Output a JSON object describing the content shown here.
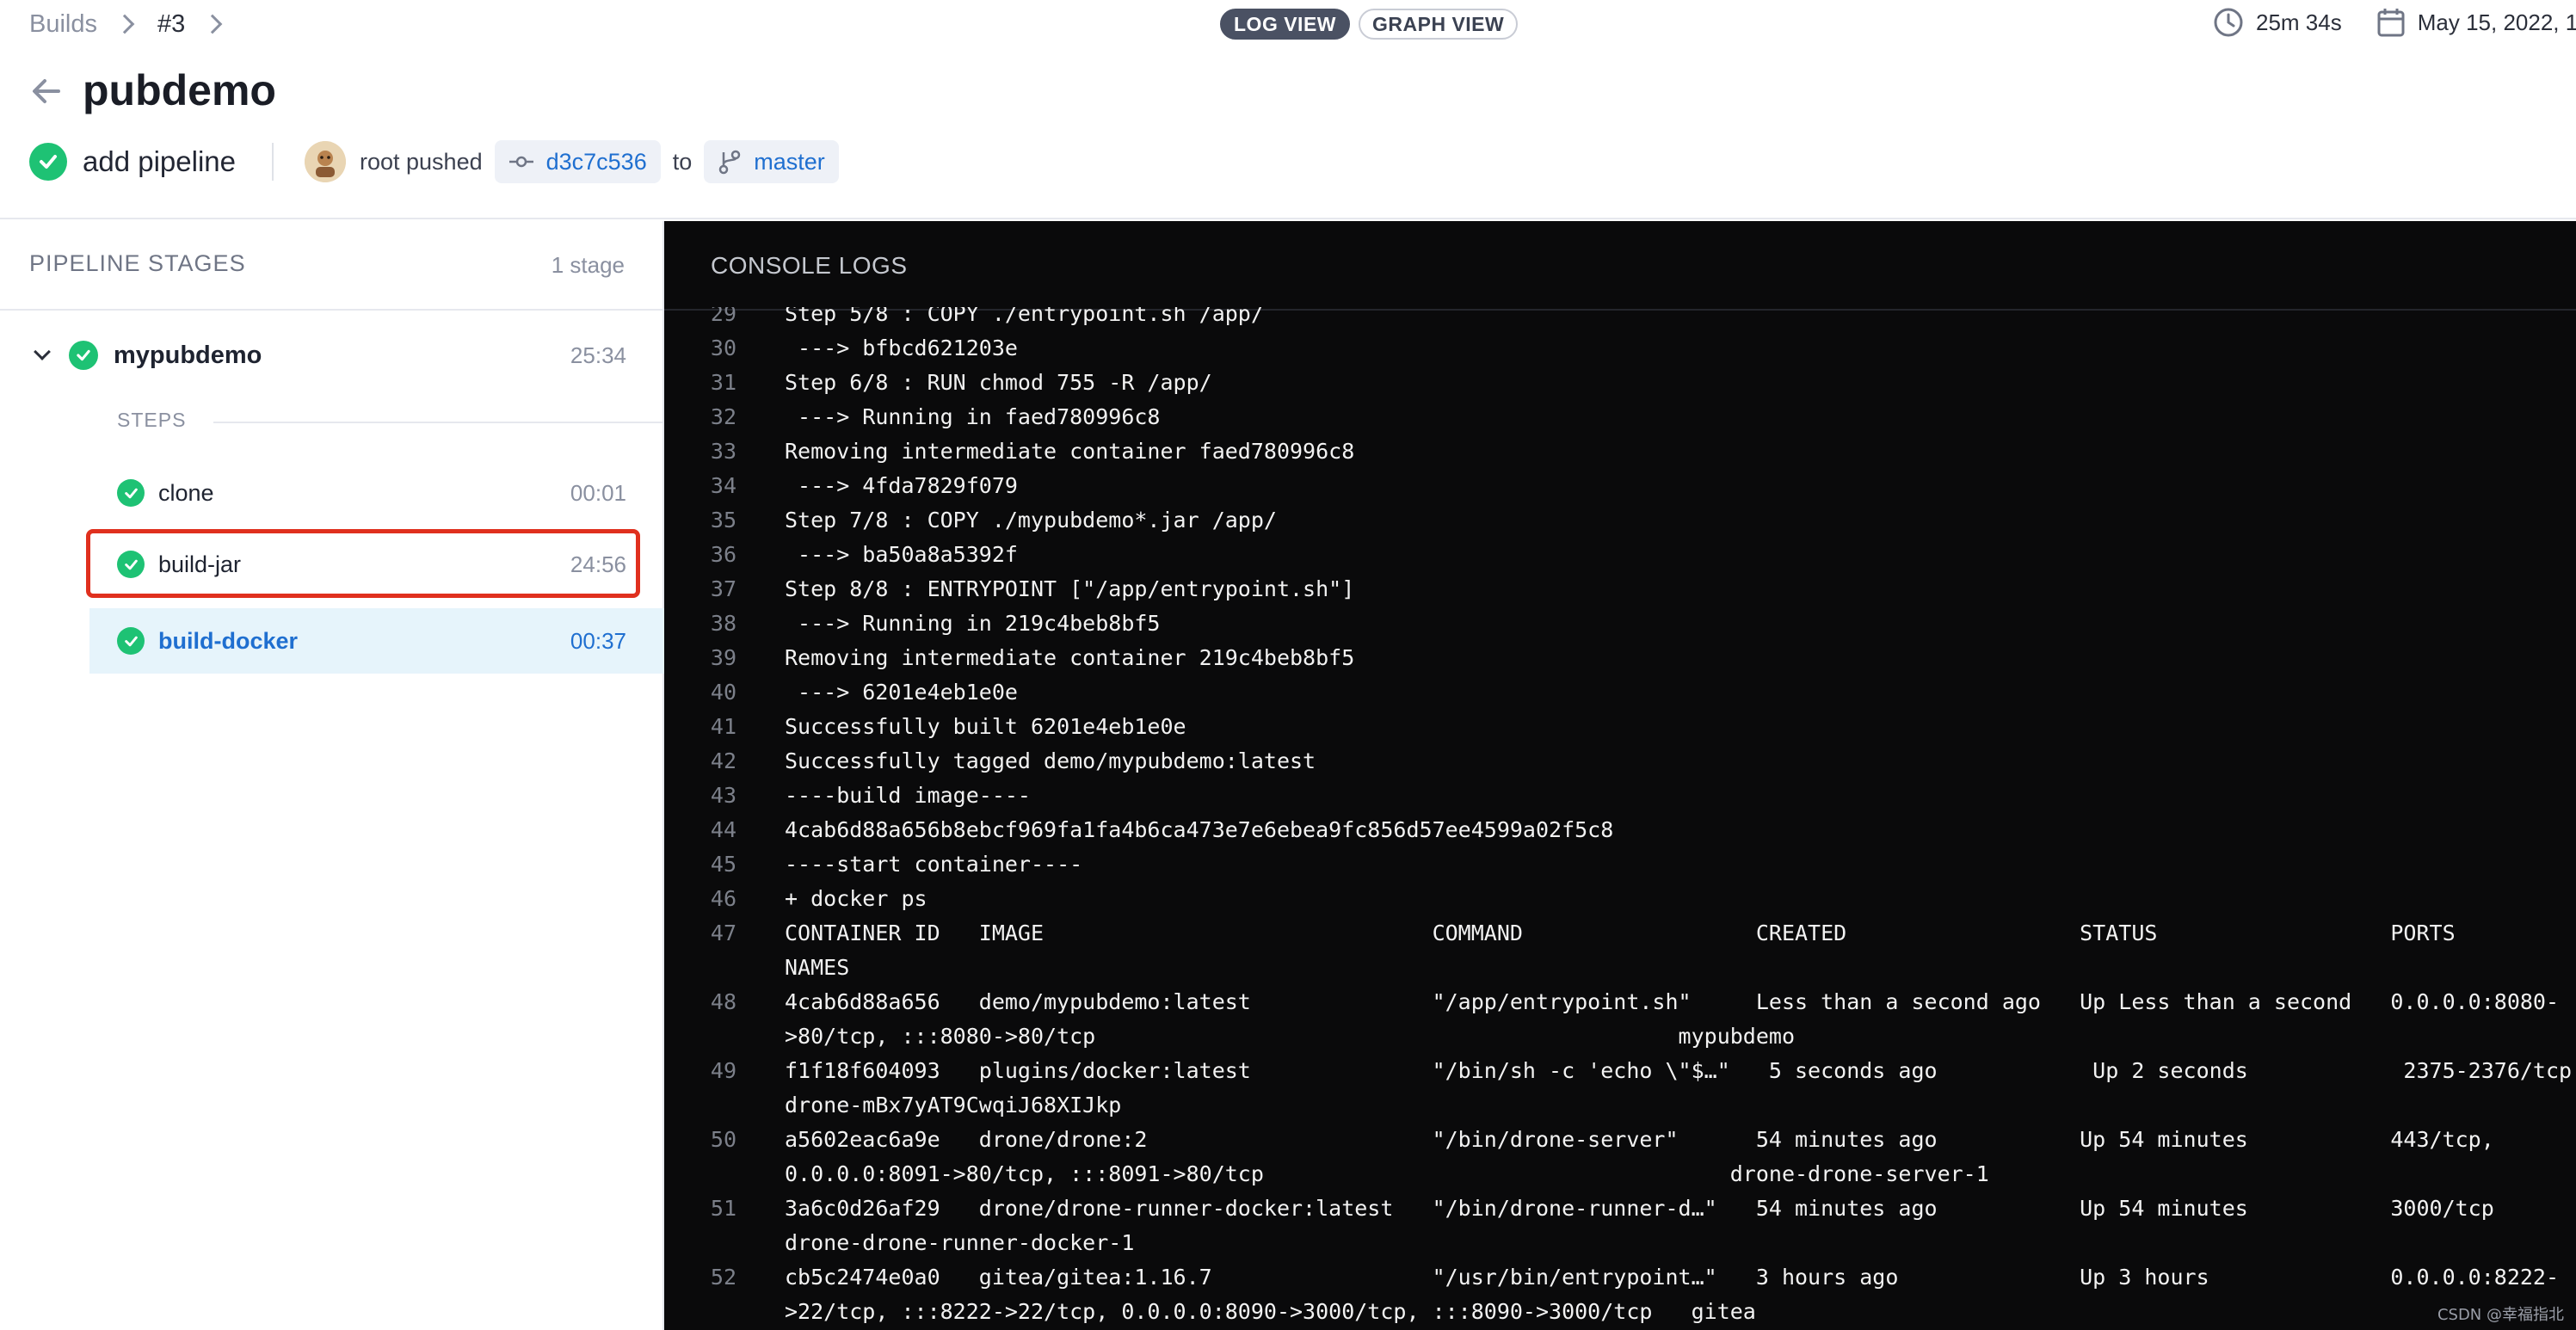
{
  "header": {
    "breadcrumb": {
      "builds": "Builds",
      "current": "#3"
    },
    "view_toggle": {
      "log": "LOG VIEW",
      "graph": "GRAPH VIEW"
    },
    "duration": "25m 34s",
    "date": "May 15, 2022, 1",
    "title": "pubdemo",
    "commit_message": "add pipeline",
    "author_action": "root pushed",
    "commit_sha": "d3c7c536",
    "to_word": "to",
    "branch": "master"
  },
  "stages_panel": {
    "title": "PIPELINE STAGES",
    "count": "1 stage",
    "stage": {
      "name": "mypubdemo",
      "time": "25:34"
    },
    "steps_label": "STEPS",
    "steps": [
      {
        "name": "clone",
        "time": "00:01"
      },
      {
        "name": "build-jar",
        "time": "24:56"
      },
      {
        "name": "build-docker",
        "time": "00:37"
      }
    ]
  },
  "console": {
    "title": "CONSOLE LOGS",
    "lines": [
      {
        "n": "29",
        "t": "Step 5/8 : COPY ./entrypoint.sh /app/"
      },
      {
        "n": "30",
        "t": " ---> bfbcd621203e"
      },
      {
        "n": "31",
        "t": "Step 6/8 : RUN chmod 755 -R /app/"
      },
      {
        "n": "32",
        "t": " ---> Running in faed780996c8"
      },
      {
        "n": "33",
        "t": "Removing intermediate container faed780996c8"
      },
      {
        "n": "34",
        "t": " ---> 4fda7829f079"
      },
      {
        "n": "35",
        "t": "Step 7/8 : COPY ./mypubdemo*.jar /app/"
      },
      {
        "n": "36",
        "t": " ---> ba50a8a5392f"
      },
      {
        "n": "37",
        "t": "Step 8/8 : ENTRYPOINT [\"/app/entrypoint.sh\"]"
      },
      {
        "n": "38",
        "t": " ---> Running in 219c4beb8bf5"
      },
      {
        "n": "39",
        "t": "Removing intermediate container 219c4beb8bf5"
      },
      {
        "n": "40",
        "t": " ---> 6201e4eb1e0e"
      },
      {
        "n": "41",
        "t": "Successfully built 6201e4eb1e0e"
      },
      {
        "n": "42",
        "t": "Successfully tagged demo/mypubdemo:latest"
      },
      {
        "n": "43",
        "t": "----build image----"
      },
      {
        "n": "44",
        "t": "4cab6d88a656b8ebcf969fa1fa4b6ca473e7e6ebea9fc856d57ee4599a02f5c8"
      },
      {
        "n": "45",
        "t": "----start container----"
      },
      {
        "n": "46",
        "t": "+ docker ps"
      },
      {
        "n": "47",
        "t": "CONTAINER ID   IMAGE                              COMMAND                  CREATED                  STATUS                  PORTS"
      },
      {
        "n": "",
        "t": "NAMES"
      },
      {
        "n": "48",
        "t": "4cab6d88a656   demo/mypubdemo:latest              \"/app/entrypoint.sh\"     Less than a second ago   Up Less than a second   0.0.0.0:8080-"
      },
      {
        "n": "",
        "t": ">80/tcp, :::8080->80/tcp                                             mypubdemo"
      },
      {
        "n": "49",
        "t": "f1f18f604093   plugins/docker:latest              \"/bin/sh -c 'echo \\\"$…\"   5 seconds ago            Up 2 seconds            2375-2376/tcp"
      },
      {
        "n": "",
        "t": "drone-mBx7yAT9CwqiJ68XIJkp"
      },
      {
        "n": "50",
        "t": "a5602eac6a9e   drone/drone:2                      \"/bin/drone-server\"      54 minutes ago           Up 54 minutes           443/tcp,"
      },
      {
        "n": "",
        "t": "0.0.0.0:8091->80/tcp, :::8091->80/tcp                                    drone-drone-server-1"
      },
      {
        "n": "51",
        "t": "3a6c0d26af29   drone/drone-runner-docker:latest   \"/bin/drone-runner-d…\"   54 minutes ago           Up 54 minutes           3000/tcp"
      },
      {
        "n": "",
        "t": "drone-drone-runner-docker-1"
      },
      {
        "n": "52",
        "t": "cb5c2474e0a0   gitea/gitea:1.16.7                 \"/usr/bin/entrypoint…\"   3 hours ago              Up 3 hours              0.0.0.0:8222-"
      },
      {
        "n": "",
        "t": ">22/tcp, :::8222->22/tcp, 0.0.0.0:8090->3000/tcp, :::8090->3000/tcp   gitea"
      }
    ]
  },
  "watermark": "CSDN @幸福指北",
  "colors": {
    "success": "#1ec274",
    "link": "#1f6fd0",
    "console_bg": "#0a0a0b",
    "highlight": "#e0301e"
  }
}
